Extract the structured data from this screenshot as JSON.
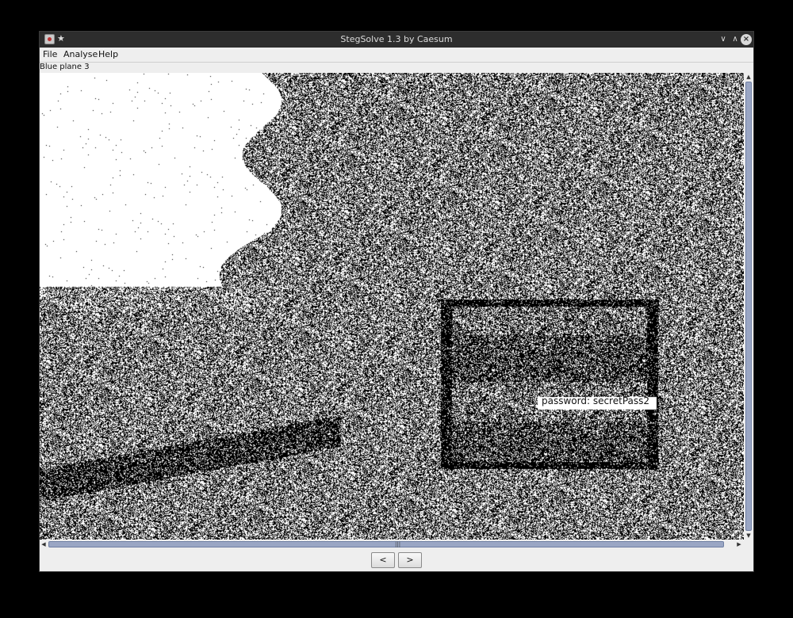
{
  "window": {
    "title": "StegSolve 1.3 by Caesum",
    "pin_glyph": "★",
    "minimize_glyph": "∨",
    "maximize_glyph": "∧",
    "close_glyph": "×"
  },
  "menu": {
    "file": "File",
    "analyse": "Analyse",
    "help": "Help"
  },
  "plane_label": "Blue plane 3",
  "image_overlay_text": "password: secretPass2",
  "scroll": {
    "up_arrow": "▲",
    "down_arrow": "▼",
    "left_arrow": "◀",
    "right_arrow": "▶",
    "grip": "|||"
  },
  "nav": {
    "prev_label": "<",
    "next_label": ">"
  },
  "colors": {
    "title_bar": "#2d2d2d",
    "window_bg": "#eeeeee",
    "scroll_thumb": "#9aa6c4",
    "noise_dark": "#000000",
    "noise_light": "#ffffff"
  }
}
